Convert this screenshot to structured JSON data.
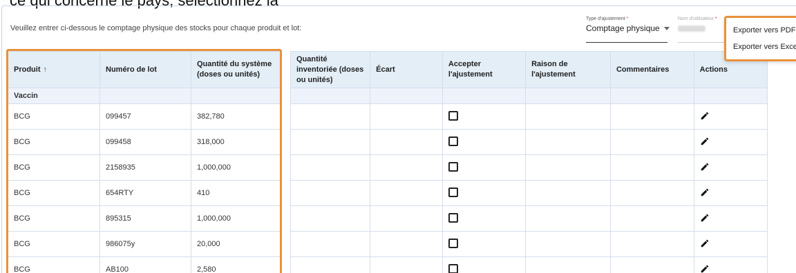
{
  "top_text": "ce qui concerne le pays, sélectionnez la",
  "instructions": "Veuillez entrer ci-dessous le comptage physique des stocks pour chaque produit et lot:",
  "adjustment_type": {
    "label": "Type d'ajustement",
    "required": "*",
    "value": "Comptage physique"
  },
  "username": {
    "label": "Nom d'utilisateur",
    "required": "*"
  },
  "export_menu": {
    "pdf": "Exporter vers PDF",
    "excel": "Exporter vers Excel"
  },
  "left_headers": {
    "product": "Produit",
    "lot": "Numéro de lot",
    "system_qty": "Quantité du système (doses ou unités)"
  },
  "right_headers": {
    "inventoried_qty": "Quantité inventoriée (doses ou unités)",
    "variance": "Écart",
    "accept": "Accepter l'ajustement",
    "reason": "Raison de l'ajustement",
    "comments": "Commentaires",
    "actions": "Actions"
  },
  "group": {
    "label": "Vaccin"
  },
  "rows": [
    {
      "product": "BCG",
      "lot": "099457",
      "system_qty": "382,780"
    },
    {
      "product": "BCG",
      "lot": "099458",
      "system_qty": "318,000"
    },
    {
      "product": "BCG",
      "lot": "2158935",
      "system_qty": "1,000,000"
    },
    {
      "product": "BCG",
      "lot": "654RTY",
      "system_qty": "410"
    },
    {
      "product": "BCG",
      "lot": "895315",
      "system_qty": "1,000,000"
    },
    {
      "product": "BCG",
      "lot": "986075y",
      "system_qty": "20,000"
    },
    {
      "product": "BCG",
      "lot": "AB100",
      "system_qty": "2,580"
    }
  ],
  "icons": {
    "sort": "arrow-up-icon",
    "edit": "pencil-icon",
    "checkbox": "checkbox-unchecked-icon",
    "dropdown": "caret-down-icon"
  },
  "colors": {
    "highlight": "#e8913a",
    "header_bg": "#e3eef7",
    "group_bg": "#eef2fb",
    "border": "#d5dceb"
  }
}
